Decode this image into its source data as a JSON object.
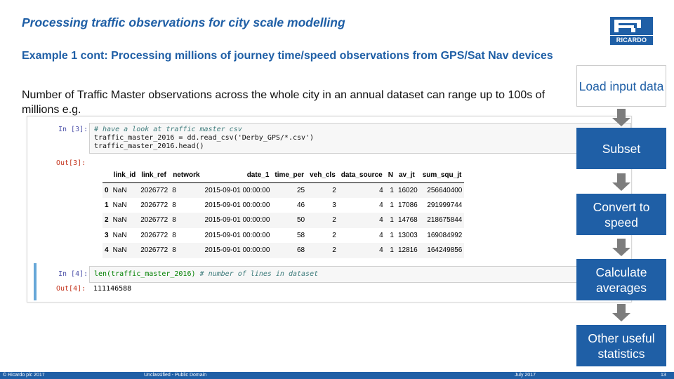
{
  "title": "Processing traffic observations for city scale modelling",
  "subtitle": "Example 1 cont: Processing millions of journey time/speed observations from GPS/Sat Nav devices",
  "body_text": "Number of  Traffic Master observations across the whole city in an annual dataset can range up to 100s of millions e.g.",
  "logo": {
    "text": "RICARDO",
    "color": "#1f5fa6"
  },
  "notebook": {
    "in3_prompt": "In [3]:",
    "in3_lines": [
      "# have a look at traffic master csv",
      "traffic_master_2016 = dd.read_csv('Derby_GPS/*.csv')",
      "traffic_master_2016.head()"
    ],
    "out3_prompt": "Out[3]:",
    "table": {
      "columns": [
        "",
        "link_id",
        "link_ref",
        "network",
        "date_1",
        "time_per",
        "veh_cls",
        "data_source",
        "N",
        "av_jt",
        "sum_squ_jt"
      ],
      "rows": [
        [
          "0",
          "NaN",
          "2026772",
          "8",
          "2015-09-01 00:00:00",
          "25",
          "2",
          "4",
          "1",
          "16020",
          "256640400"
        ],
        [
          "1",
          "NaN",
          "2026772",
          "8",
          "2015-09-01 00:00:00",
          "46",
          "3",
          "4",
          "1",
          "17086",
          "291999744"
        ],
        [
          "2",
          "NaN",
          "2026772",
          "8",
          "2015-09-01 00:00:00",
          "50",
          "2",
          "4",
          "1",
          "14768",
          "218675844"
        ],
        [
          "3",
          "NaN",
          "2026772",
          "8",
          "2015-09-01 00:00:00",
          "58",
          "2",
          "4",
          "1",
          "13003",
          "169084992"
        ],
        [
          "4",
          "NaN",
          "2026772",
          "8",
          "2015-09-01 00:00:00",
          "68",
          "2",
          "4",
          "1",
          "12816",
          "164249856"
        ]
      ]
    },
    "in4_prompt": "In [4]:",
    "in4_code": "len(traffic_master_2016)",
    "in4_comment": "# number of lines in dataset",
    "out4_prompt": "Out[4]:",
    "out4_value": "111146588"
  },
  "process_steps": [
    "Load input data",
    "Subset",
    "Convert to speed",
    "Calculate averages",
    "Other useful statistics"
  ],
  "footer": {
    "copyright": "© Ricardo plc 2017",
    "classification": "Unclassified - Public Domain",
    "date": "July 2017",
    "page": "13"
  }
}
